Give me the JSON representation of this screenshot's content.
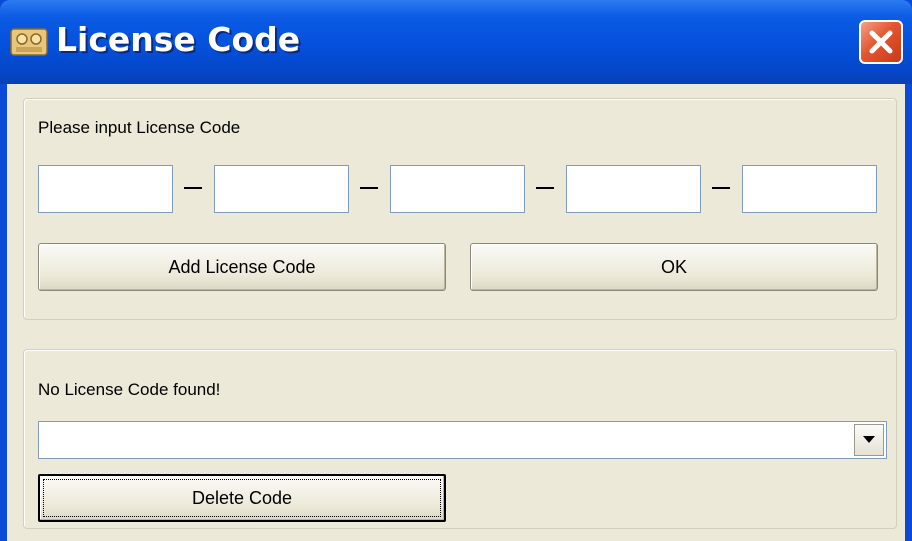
{
  "window": {
    "title": "License Code",
    "icon": "key-app-icon",
    "close_icon": "close-icon",
    "accent": "#0552dd",
    "close_color": "#e2552f"
  },
  "license_group": {
    "prompt_label": "Please input License Code",
    "segments": [
      "",
      "",
      "",
      "",
      ""
    ],
    "add_button_label": "Add License Code",
    "ok_button_label": "OK"
  },
  "existing_group": {
    "status_label": "No License Code found!",
    "selected_code": "",
    "dropdown_icon": "chevron-down-icon",
    "delete_button_label": "Delete Code"
  }
}
